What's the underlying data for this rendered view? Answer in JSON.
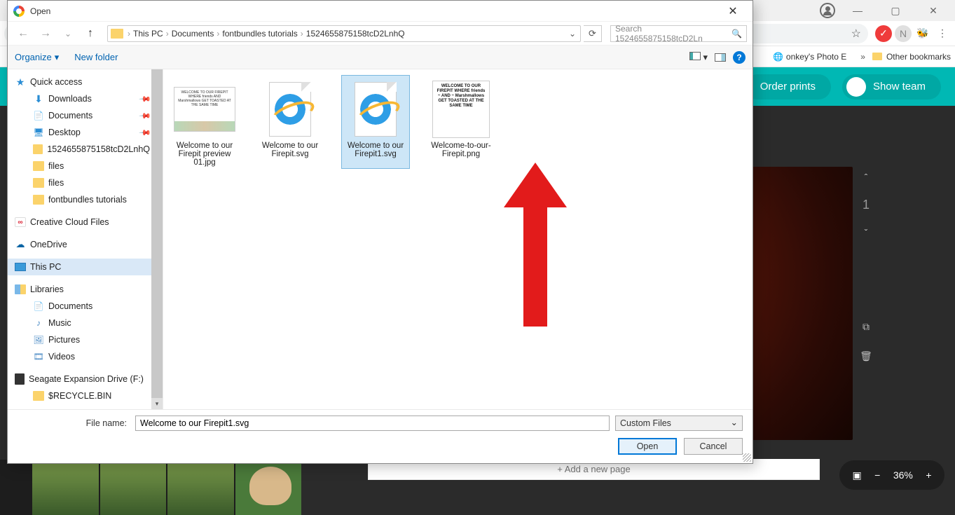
{
  "chrome": {
    "min": "—",
    "max": "▢",
    "close": "✕",
    "bookmark_partial": "onkey's Photo E",
    "bookmark_chev": "»",
    "other_bookmarks": "Other bookmarks"
  },
  "app": {
    "order_prints": "Order prints",
    "show_team": "Show team"
  },
  "canvas": {
    "page_number": "1",
    "add_page": "+ Add a new page"
  },
  "zoom": {
    "minus": "−",
    "value": "36%",
    "plus": "+",
    "present": "▣"
  },
  "dialog": {
    "title": "Open",
    "close": "✕",
    "nav": {
      "back": "←",
      "forward": "→",
      "recent": "⌄",
      "up": "↑",
      "refresh": "⟳"
    },
    "breadcrumbs": [
      "This PC",
      "Documents",
      "fontbundles tutorials",
      "1524655875158tcD2LnhQ"
    ],
    "search_placeholder": "Search 1524655875158tcD2Ln",
    "organize": "Organize",
    "new_folder": "New folder",
    "filename_label": "File name:",
    "filename_value": "Welcome to our Firepit1.svg",
    "filter": "Custom Files",
    "open": "Open",
    "cancel": "Cancel"
  },
  "tree": {
    "quick_access": "Quick access",
    "downloads": "Downloads",
    "documents": "Documents",
    "desktop": "Desktop",
    "folder_long": "1524655875158tcD2LnhQ",
    "files1": "files",
    "files2": "files",
    "fontbundles": "fontbundles tutorials",
    "ccfiles": "Creative Cloud Files",
    "onedrive": "OneDrive",
    "thispc": "This PC",
    "libraries": "Libraries",
    "lib_docs": "Documents",
    "lib_music": "Music",
    "lib_pics": "Pictures",
    "lib_vids": "Videos",
    "seagate": "Seagate Expansion Drive (F:)",
    "recycle": "$RECYCLE.BIN"
  },
  "files": [
    {
      "name": "Welcome to our Firepit preview 01.jpg",
      "kind": "jpg"
    },
    {
      "name": "Welcome to our Firepit.svg",
      "kind": "svg"
    },
    {
      "name": "Welcome to our Firepit1.svg",
      "kind": "svg",
      "selected": true
    },
    {
      "name": "Welcome-to-our-Firepit.png",
      "kind": "png"
    }
  ],
  "thumb_text": {
    "jpg": "WELCOME\nTO OUR FIREPIT\nWHERE\nfriends\nAND\nMarshmallows\nGET TOASTED\nAT THE SAME TIME",
    "png": "WELCOME\nTO OUR FIREPIT\nWHERE\nfriends\n~ AND ~\nMarshmallows\nGET TOASTED\nAT THE SAME TIME"
  }
}
